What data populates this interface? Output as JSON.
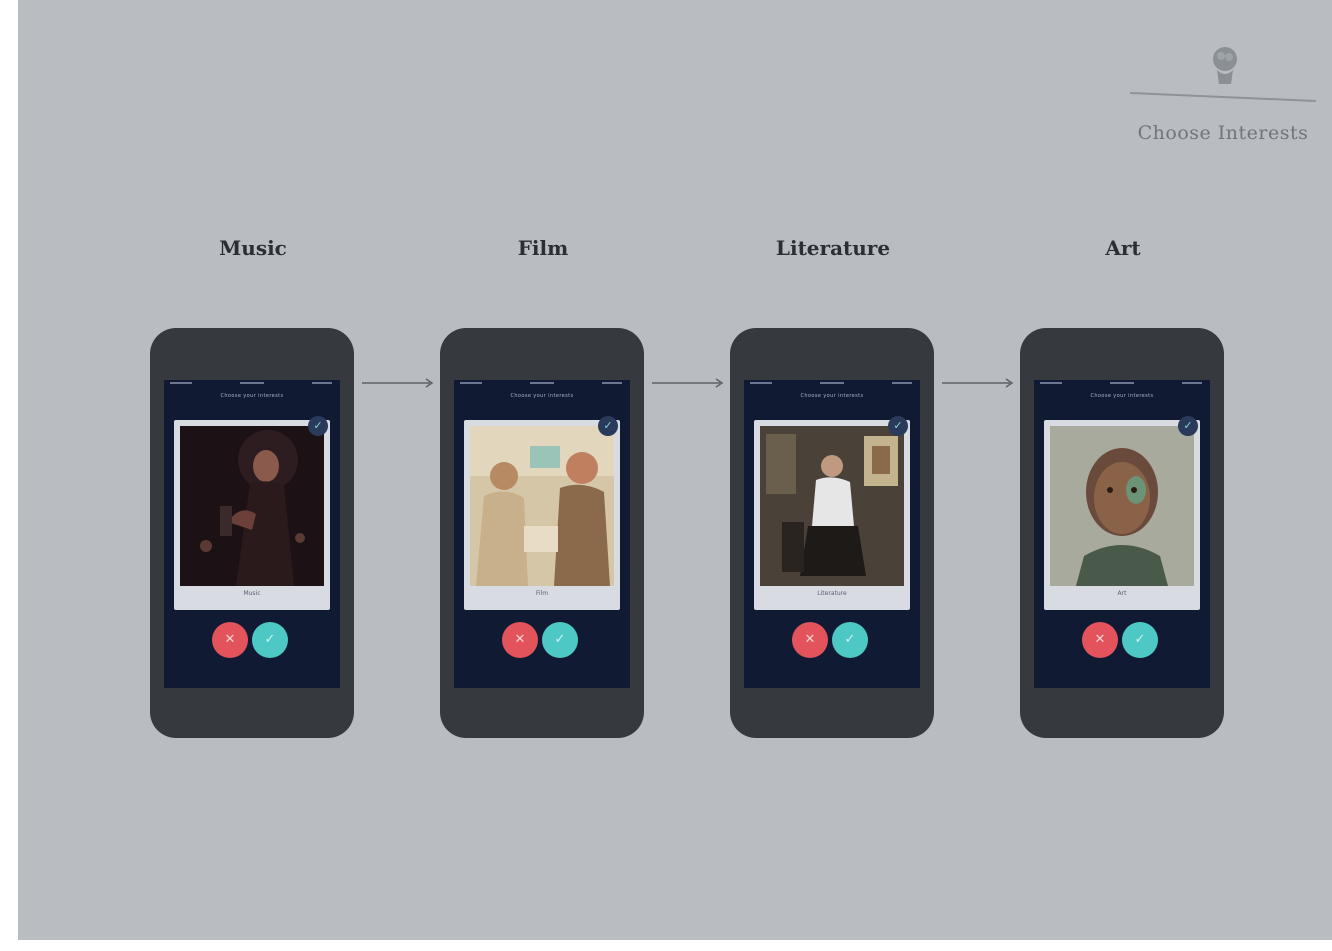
{
  "brand": {
    "title": "Choose Interests",
    "icon": "brain-head-icon",
    "color": "#6f757c"
  },
  "colors": {
    "background": "#b9bdc2",
    "phone": "#36393e",
    "screen": "#111a33",
    "dislike": "#e2535b",
    "like": "#4ec8c4"
  },
  "app": {
    "header_text": "Choose your interests",
    "check_icon": "check-icon",
    "dislike_icon": "close-icon",
    "like_icon": "check-icon"
  },
  "steps": [
    {
      "title": "Music",
      "card_label": "Music",
      "image": "concert-singer-photo"
    },
    {
      "title": "Film",
      "card_label": "Film",
      "image": "film-still-photo"
    },
    {
      "title": "Literature",
      "card_label": "Literature",
      "image": "author-portrait-photo"
    },
    {
      "title": "Art",
      "card_label": "Art",
      "image": "painted-portrait-photo"
    }
  ]
}
